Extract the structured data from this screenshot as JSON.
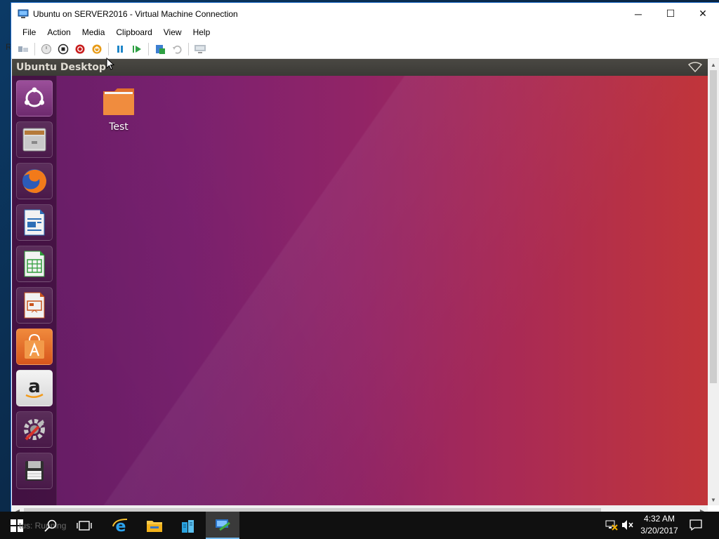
{
  "window": {
    "title": "Ubuntu on SERVER2016 - Virtual Machine Connection",
    "minimize_glyph": "─",
    "maximize_glyph": "☐",
    "close_glyph": "✕"
  },
  "menu": {
    "items": [
      {
        "label": "File"
      },
      {
        "label": "Action"
      },
      {
        "label": "Media"
      },
      {
        "label": "Clipboard"
      },
      {
        "label": "View"
      },
      {
        "label": "Help"
      }
    ]
  },
  "toolbar": {
    "buttons": [
      {
        "name": "ctrl-alt-del-icon"
      },
      {
        "name": "start-icon"
      },
      {
        "name": "turn-off-icon"
      },
      {
        "name": "shut-down-icon"
      },
      {
        "name": "save-icon"
      },
      {
        "name": "pause-icon"
      },
      {
        "name": "reset-icon"
      },
      {
        "name": "checkpoint-icon"
      },
      {
        "name": "revert-icon"
      },
      {
        "name": "enhanced-session-icon"
      }
    ]
  },
  "guest": {
    "panel_title": "Ubuntu Desktop",
    "desktop_icon_label": "Test",
    "launcher": [
      {
        "name": "ubuntu-dash-icon"
      },
      {
        "name": "files-icon"
      },
      {
        "name": "firefox-icon"
      },
      {
        "name": "libreoffice-writer-icon"
      },
      {
        "name": "libreoffice-calc-icon"
      },
      {
        "name": "libreoffice-impress-icon"
      },
      {
        "name": "ubuntu-software-icon"
      },
      {
        "name": "amazon-icon"
      },
      {
        "name": "system-settings-icon"
      },
      {
        "name": "trash-disk-icon"
      }
    ]
  },
  "host_fragments": {
    "left_letter": "R",
    "status_ghost": "tus: Running"
  },
  "taskbar": {
    "time": "4:32 AM",
    "date": "3/20/2017"
  },
  "colors": {
    "accent": "#1b6ac9",
    "taskbar": "#101010",
    "ubuntu_panel": "#3b3a36",
    "wallpaper_left": "#6a1e6b",
    "wallpaper_right": "#c1353a"
  }
}
